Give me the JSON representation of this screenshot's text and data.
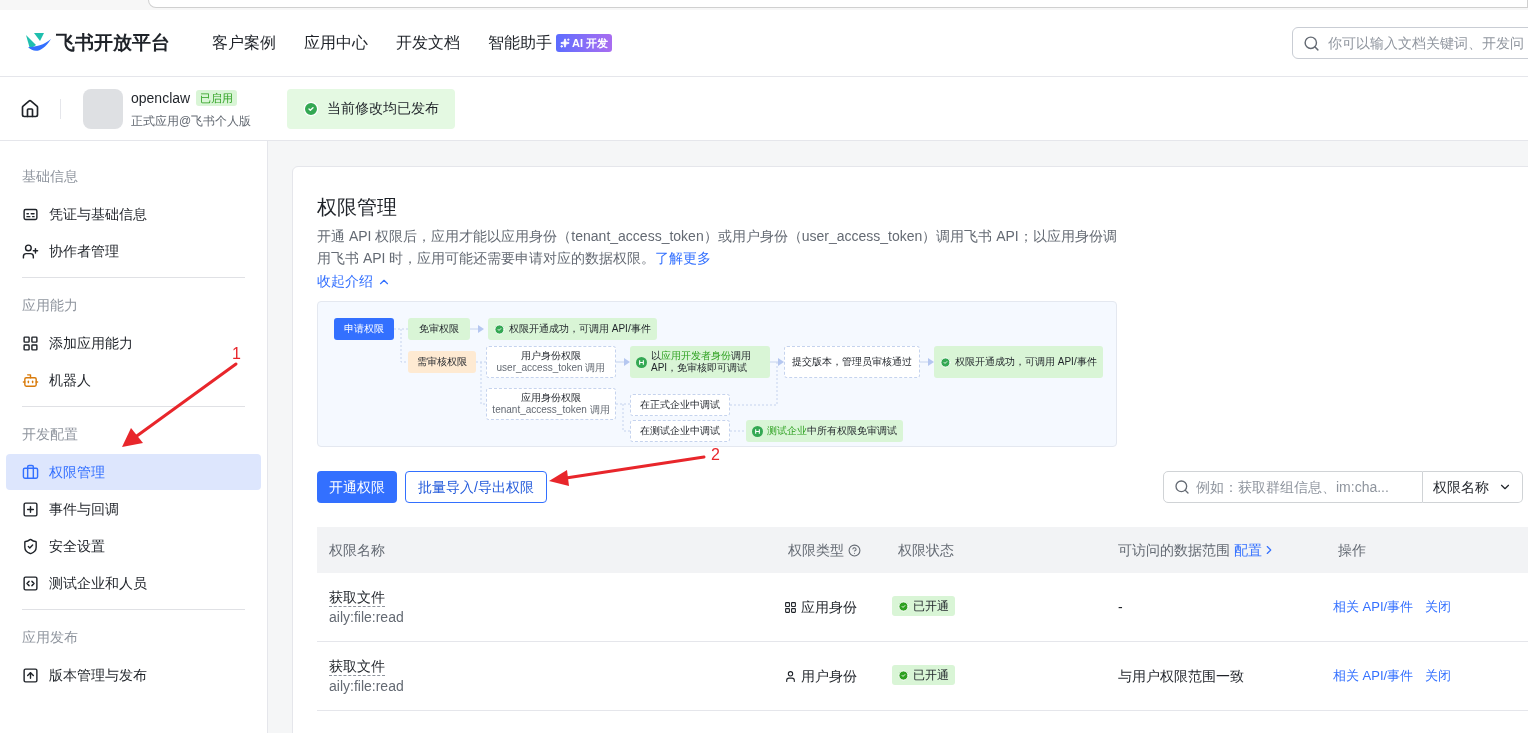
{
  "header": {
    "brand": "飞书开放平台",
    "nav": [
      {
        "label": "客户案例"
      },
      {
        "label": "应用中心"
      },
      {
        "label": "开发文档"
      },
      {
        "label": "智能助手",
        "badge": "AI 开发"
      }
    ],
    "search": {
      "placeholder": "你可以输入文档关键词、开发问"
    }
  },
  "app_bar": {
    "name": "openclaw",
    "status": "已启用",
    "subtitle": "正式应用@飞书个人版",
    "notice": "当前修改均已发布"
  },
  "sidebar": {
    "groups": [
      {
        "title": "基础信息",
        "items": [
          {
            "label": "凭证与基础信息",
            "selected": false
          },
          {
            "label": "协作者管理",
            "selected": false
          }
        ]
      },
      {
        "title": "应用能力",
        "items": [
          {
            "label": "添加应用能力",
            "selected": false
          },
          {
            "label": "机器人",
            "selected": false
          }
        ]
      },
      {
        "title": "开发配置",
        "items": [
          {
            "label": "权限管理",
            "selected": true
          },
          {
            "label": "事件与回调",
            "selected": false
          },
          {
            "label": "安全设置",
            "selected": false
          },
          {
            "label": "测试企业和人员",
            "selected": false
          }
        ]
      },
      {
        "title": "应用发布",
        "items": [
          {
            "label": "版本管理与发布",
            "selected": false
          }
        ]
      }
    ]
  },
  "page": {
    "title": "权限管理",
    "description": "开通 API 权限后，应用才能以应用身份（tenant_access_token）或用户身份（user_access_token）调用飞书 API；以应用身份调用飞书 API 时，应用可能还需要申请对应的数据权限。",
    "learn_more": "了解更多",
    "collapse": "收起介绍",
    "diagram": {
      "nodes": [
        {
          "kind": "start",
          "label": "申请权限"
        },
        {
          "kind": "tag_green",
          "label": "免审权限"
        },
        {
          "kind": "result",
          "label": "权限开通成功，可调用 API/事件"
        },
        {
          "kind": "tag_orange",
          "label": "需审核权限"
        },
        {
          "kind": "plain",
          "label": "用户身份权限",
          "note": "user_access_token 调用"
        },
        {
          "kind": "dev",
          "segments": [
            {
              "text": "以",
              "highlight": false
            },
            {
              "text": "应用开发者身份",
              "highlight": true
            },
            {
              "text": "调用 API，免审核即可调试",
              "highlight": false
            }
          ]
        },
        {
          "kind": "plain",
          "label": "提交版本，管理员审核通过"
        },
        {
          "kind": "result",
          "label": "权限开通成功，可调用 API/事件"
        },
        {
          "kind": "plain",
          "label": "应用身份权限",
          "note": "tenant_access_token 调用"
        },
        {
          "kind": "plain",
          "label": "在正式企业中调试"
        },
        {
          "kind": "plain",
          "label": "在测试企业中调试"
        },
        {
          "kind": "dev",
          "segments": [
            {
              "text": "测试企业",
              "highlight": true
            },
            {
              "text": "中所有权限免审调试",
              "highlight": false
            }
          ]
        }
      ]
    },
    "buttons": {
      "primary": "开通权限",
      "secondary": "批量导入/导出权限"
    },
    "filter": {
      "placeholder": "例如：获取群组信息、im:cha...",
      "select": "权限名称"
    },
    "table": {
      "columns": [
        "权限名称",
        "权限类型",
        "权限状态",
        "可访问的数据范围",
        "操作"
      ],
      "scope_link": "配置",
      "rows": [
        {
          "name": "获取文件",
          "scope_key": "aily:file:read",
          "kind": "app",
          "type": "应用身份",
          "status": "已开通",
          "scope": "-",
          "actions": [
            "相关 API/事件",
            "关闭"
          ]
        },
        {
          "name": "获取文件",
          "scope_key": "aily:file:read",
          "kind": "user",
          "type": "用户身份",
          "status": "已开通",
          "scope": "与用户权限范围一致",
          "actions": [
            "相关 API/事件",
            "关闭"
          ]
        }
      ]
    }
  },
  "annotations": [
    {
      "label": "1"
    },
    {
      "label": "2"
    }
  ]
}
